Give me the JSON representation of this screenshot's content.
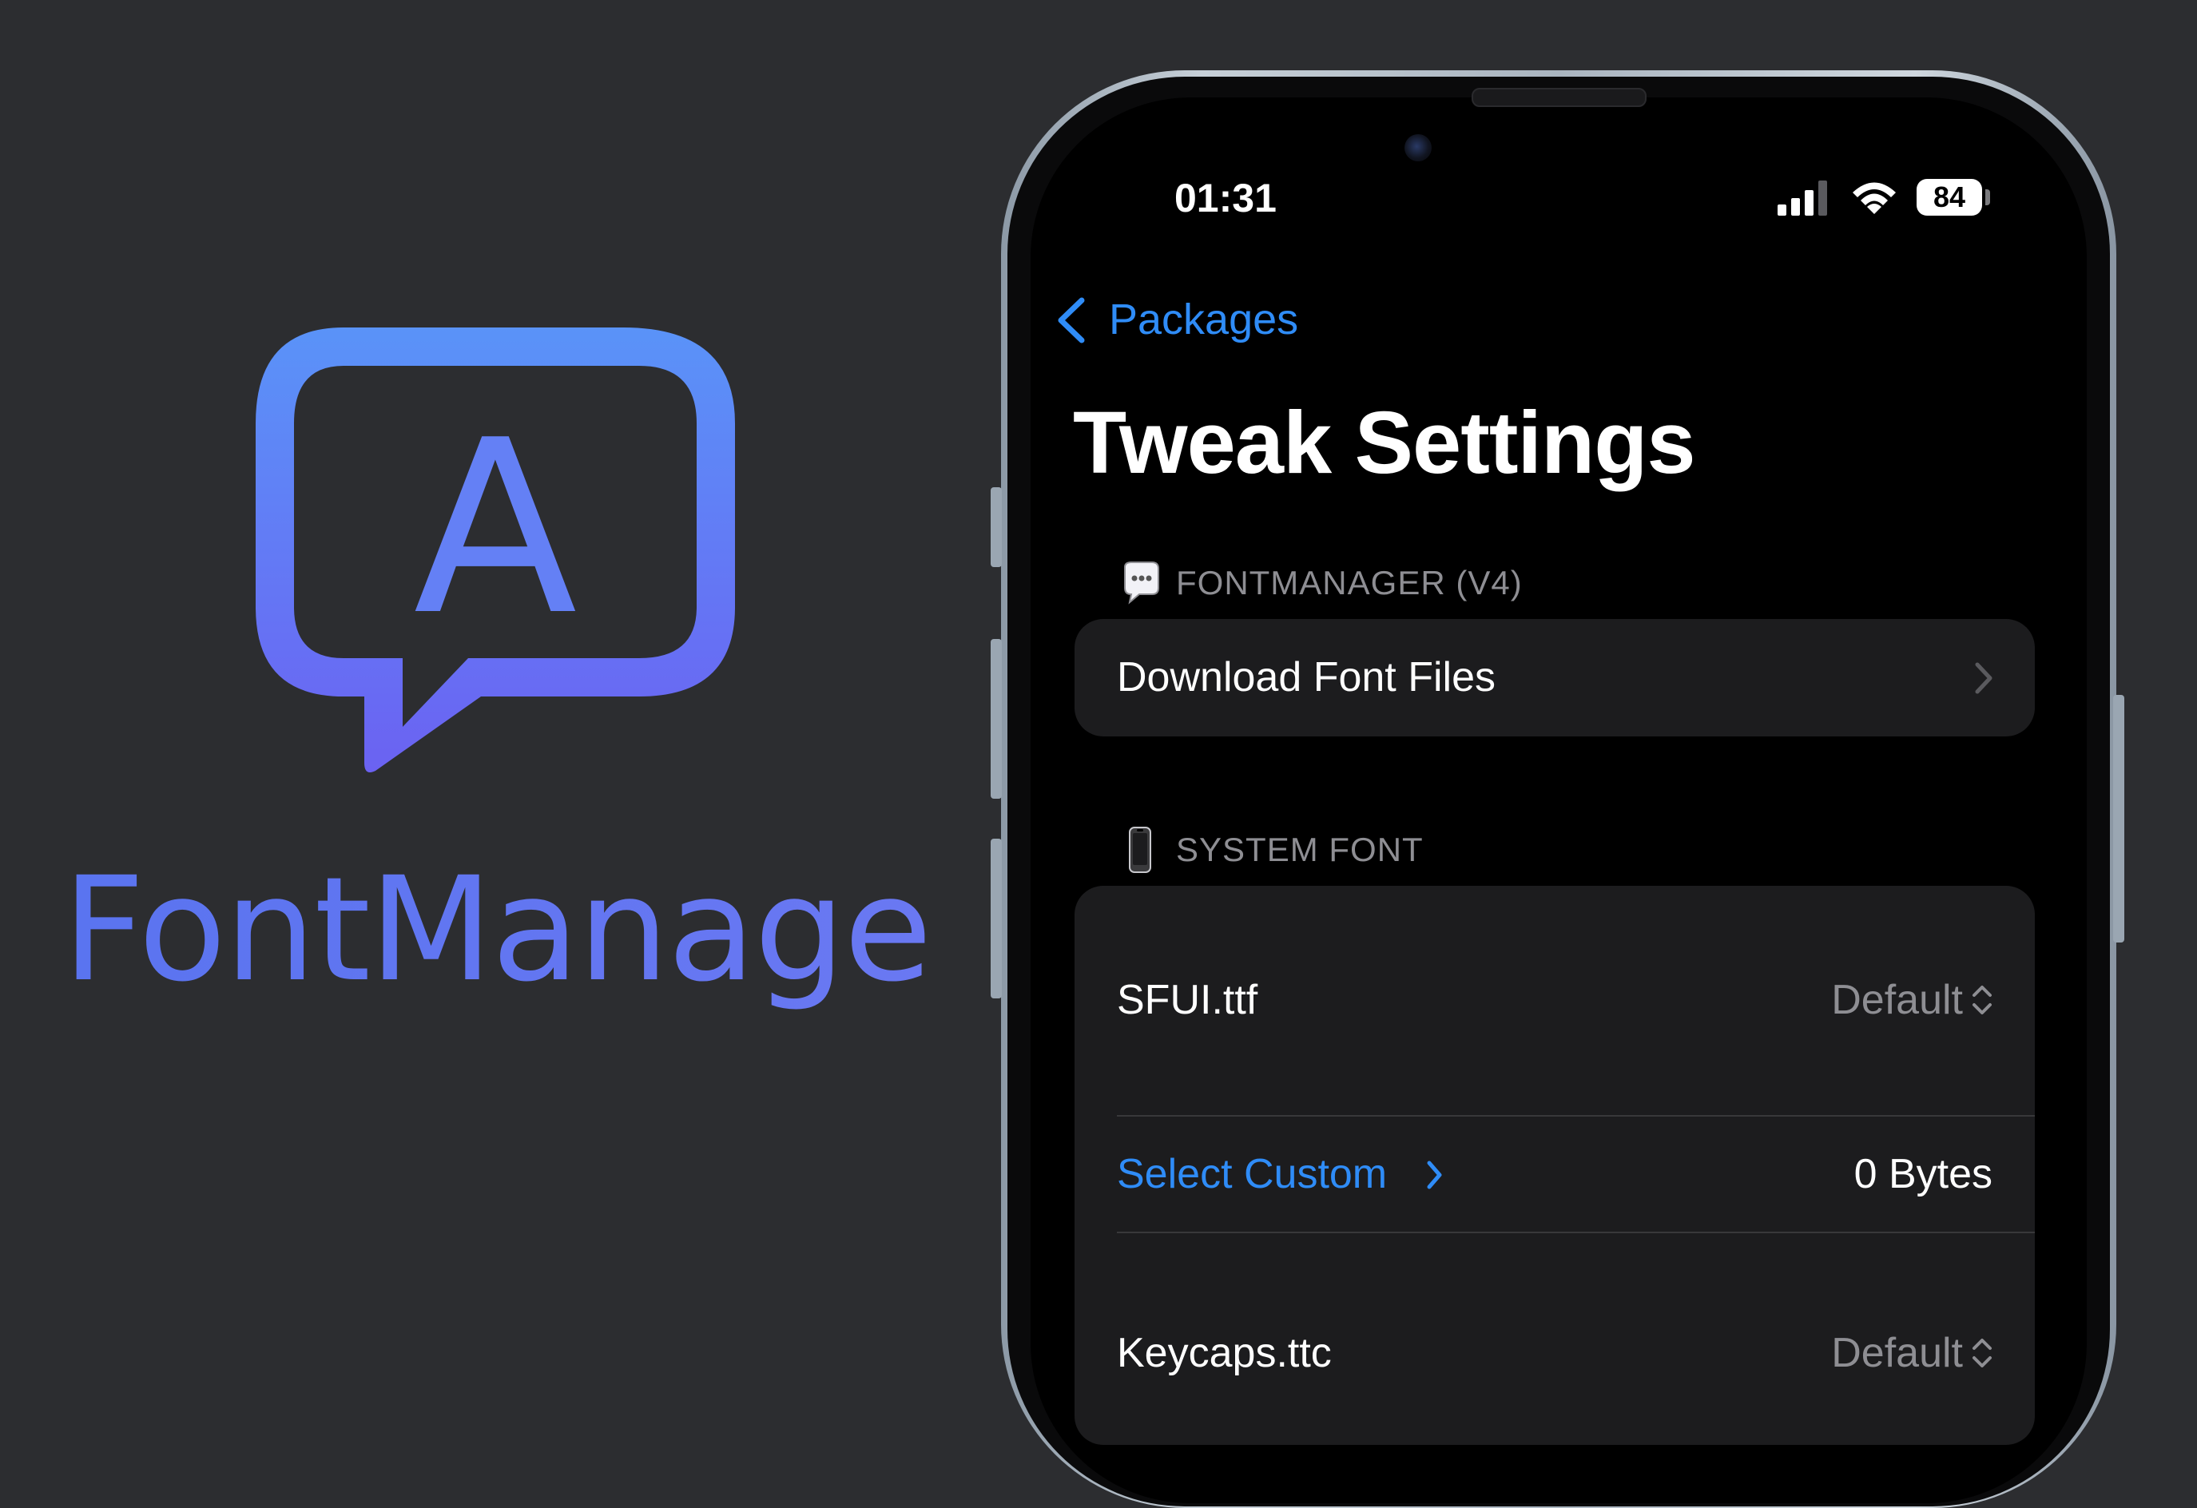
{
  "branding": {
    "logo_letter": "A",
    "app_name": "FontManager",
    "gradient_colors": [
      "#5b8df8",
      "#6a63f2"
    ]
  },
  "status_bar": {
    "time": "01:31",
    "battery_level": "84",
    "icons": [
      "cellular-signal-icon",
      "wifi-icon",
      "battery-icon"
    ]
  },
  "navigation": {
    "back_label": "Packages",
    "title": "Tweak Settings"
  },
  "sections": [
    {
      "emoji": "speech-balloon-icon",
      "header": "FONTMANAGER (V4)",
      "rows": [
        {
          "label": "Download Font Files",
          "accessory": "chevron-right-icon"
        }
      ]
    },
    {
      "emoji": "mobile-phone-icon",
      "header": "SYSTEM FONT",
      "rows": [
        {
          "label": "SFUI.ttf",
          "value": "Default",
          "accessory": "chevron-up-down-icon"
        },
        {
          "label": "Select Custom",
          "value": "0 Bytes",
          "accessory": "chevron-right-icon"
        },
        {
          "label": "Keycaps.ttc",
          "value": "Default",
          "accessory": "chevron-up-down-icon"
        }
      ]
    }
  ],
  "colors": {
    "background": "#2c2d30",
    "accent_blue": "#2f8cf7",
    "cell_background": "#1c1c1e",
    "secondary_text": "#8e8e93"
  }
}
